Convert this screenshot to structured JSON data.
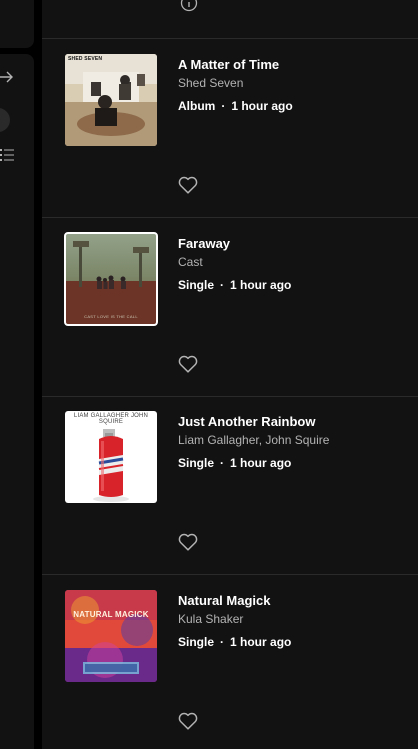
{
  "colors": {
    "background": "#000000",
    "surface": "#121212",
    "divider": "#2a2a2a",
    "text_primary": "#ffffff",
    "text_secondary": "#b3b3b3"
  },
  "sidebar": {
    "icons": [
      "arrow-right-icon",
      "list-icon"
    ]
  },
  "feed": {
    "items": [
      {
        "title": "A Matter of Time",
        "artist": "Shed Seven",
        "type": "Album",
        "time": "1 hour ago",
        "separator": "·",
        "cover_text": "SHED SEVEN"
      },
      {
        "title": "Faraway",
        "artist": "Cast",
        "type": "Single",
        "time": "1 hour ago",
        "separator": "·",
        "cover_text": "CAST  LOVE IS THE CALL"
      },
      {
        "title": "Just Another Rainbow",
        "artist": "Liam Gallagher, John Squire",
        "type": "Single",
        "time": "1 hour ago",
        "separator": "·",
        "cover_text": "LIAM GALLAGHER  JOHN SQUIRE"
      },
      {
        "title": "Natural Magick",
        "artist": "Kula Shaker",
        "type": "Single",
        "time": "1 hour ago",
        "separator": "·",
        "cover_text": "NATURAL MAGICK"
      }
    ]
  }
}
